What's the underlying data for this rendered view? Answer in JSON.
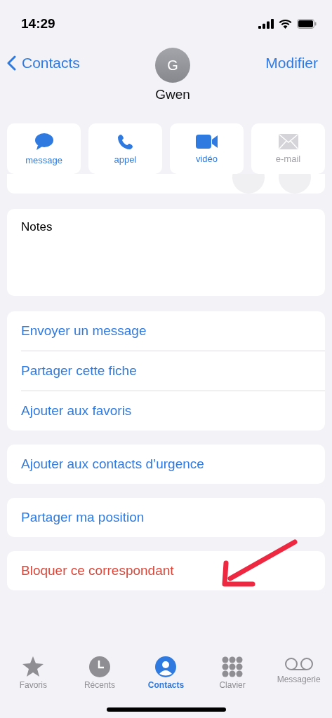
{
  "status_bar": {
    "time": "14:29"
  },
  "nav": {
    "back": "Contacts",
    "edit": "Modifier",
    "avatar_initial": "G",
    "name": "Gwen"
  },
  "actions": [
    {
      "kind": "message",
      "label": "message",
      "disabled": false
    },
    {
      "kind": "call",
      "label": "appel",
      "disabled": false
    },
    {
      "kind": "video",
      "label": "vidéo",
      "disabled": false
    },
    {
      "kind": "mail",
      "label": "e-mail",
      "disabled": true
    }
  ],
  "notes": {
    "label": "Notes"
  },
  "action_groups": [
    [
      {
        "label": "Envoyer un message",
        "destructive": false
      },
      {
        "label": "Partager cette fiche",
        "destructive": false
      },
      {
        "label": "Ajouter aux favoris",
        "destructive": false
      }
    ],
    [
      {
        "label": "Ajouter aux contacts d’urgence",
        "destructive": false
      }
    ],
    [
      {
        "label": "Partager ma position",
        "destructive": false
      }
    ],
    [
      {
        "label": "Bloquer ce correspondant",
        "destructive": true
      }
    ]
  ],
  "tab_bar": [
    {
      "kind": "star",
      "label": "Favoris",
      "selected": false
    },
    {
      "kind": "clock",
      "label": "Récents",
      "selected": false
    },
    {
      "kind": "person",
      "label": "Contacts",
      "selected": true
    },
    {
      "kind": "keypad",
      "label": "Clavier",
      "selected": false
    },
    {
      "kind": "voicemail",
      "label": "Messagerie",
      "selected": false
    }
  ]
}
